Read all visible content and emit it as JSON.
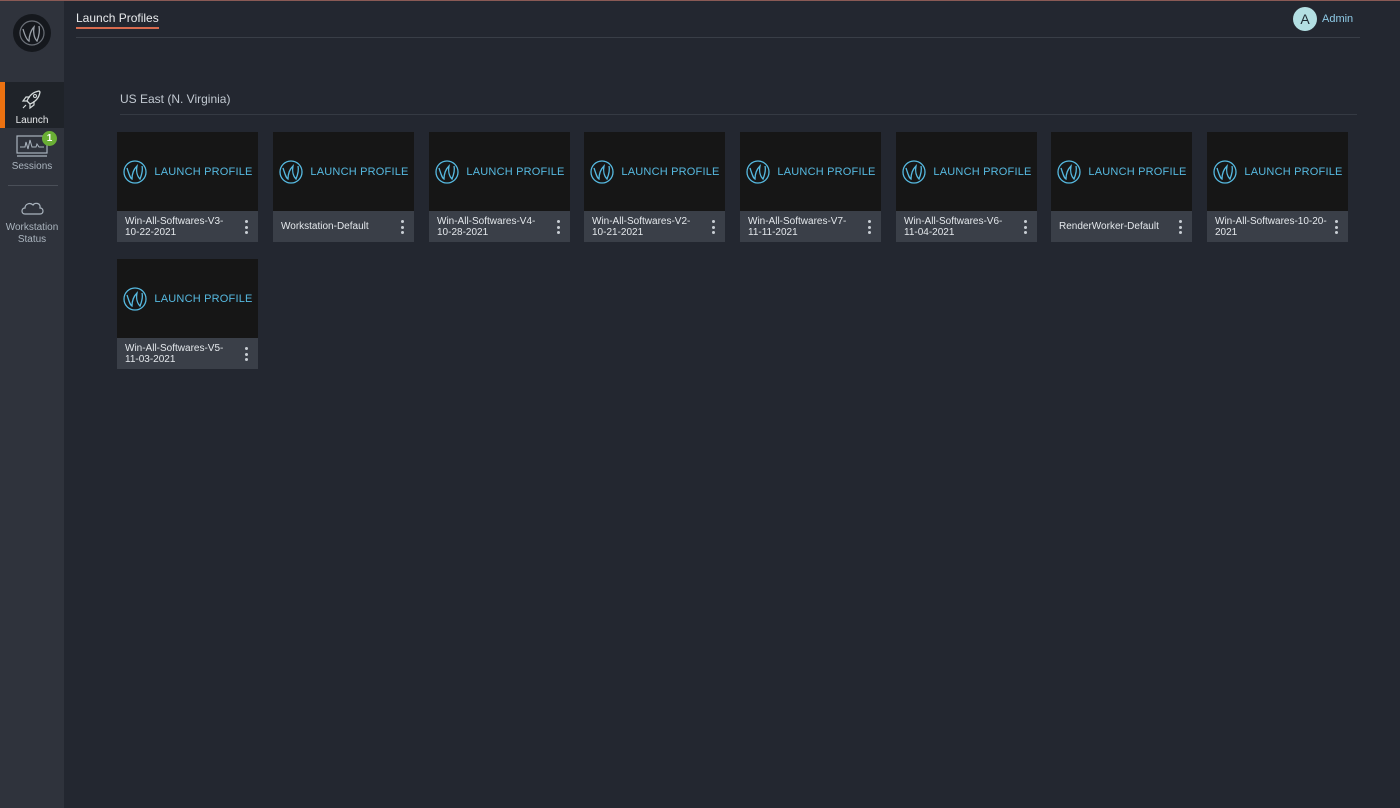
{
  "header": {
    "title": "Launch Profiles",
    "user_initial": "A",
    "user_name": "Admin"
  },
  "sidebar": {
    "items": [
      {
        "id": "launch",
        "label": "Launch",
        "icon": "rocket-icon",
        "active": true
      },
      {
        "id": "sessions",
        "label": "Sessions",
        "icon": "monitor-icon",
        "badge": "1"
      },
      {
        "id": "workstation",
        "label": "Workstation Status",
        "icon": "cloud-icon"
      }
    ]
  },
  "region": {
    "title": "US East (N. Virginia)"
  },
  "thumbnail_text": "LAUNCH PROFILE",
  "profiles": [
    {
      "name": "Win-All-Softwares-V3-10-22-2021"
    },
    {
      "name": "Workstation-Default"
    },
    {
      "name": "Win-All-Softwares-V4-10-28-2021"
    },
    {
      "name": "Win-All-Softwares-V2-10-21-2021"
    },
    {
      "name": "Win-All-Softwares-V7-11-11-2021"
    },
    {
      "name": "Win-All-Softwares-V6-11-04-2021"
    },
    {
      "name": "RenderWorker-Default"
    },
    {
      "name": "Win-All-Softwares-10-20-2021"
    },
    {
      "name": "Win-All-Softwares-V5-11-03-2021"
    }
  ],
  "colors": {
    "accent": "#ec7211",
    "badge": "#6aaf35",
    "link": "#8ecae6",
    "thumb_text": "#56b9e0"
  }
}
